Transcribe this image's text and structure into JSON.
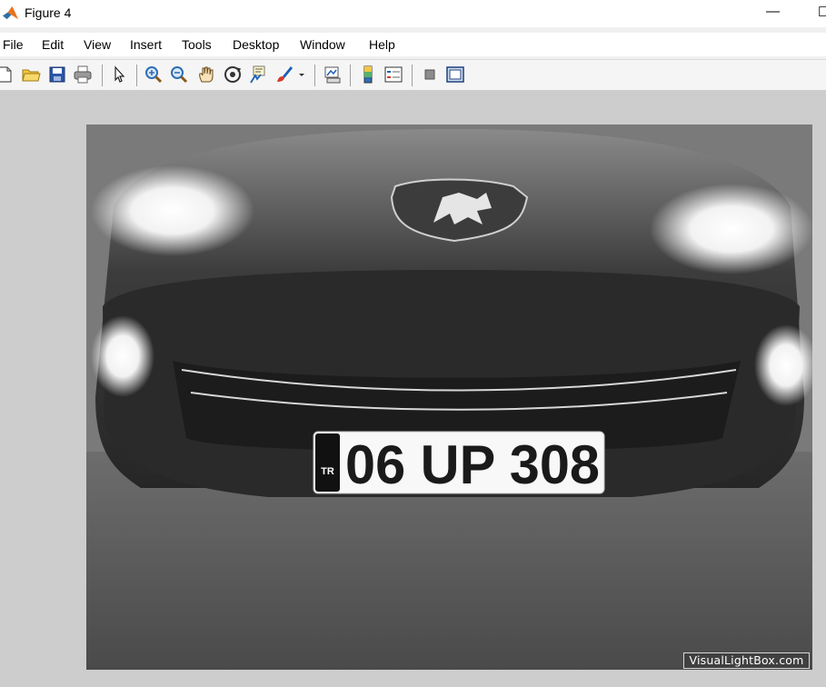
{
  "window": {
    "title": "Figure 4",
    "minimize_glyph": "—",
    "maximize_glyph": "☐"
  },
  "menu": {
    "items": [
      "File",
      "Edit",
      "View",
      "Insert",
      "Tools",
      "Desktop",
      "Window",
      "Help"
    ]
  },
  "toolbar": {
    "icons": [
      "new-figure-icon",
      "open-file-icon",
      "save-icon",
      "print-icon",
      "select-arrow-icon",
      "zoom-in-icon",
      "zoom-out-icon",
      "pan-hand-icon",
      "rotate-3d-icon",
      "data-cursor-icon",
      "brush-icon",
      "brush-dropdown-icon",
      "link-plot-icon",
      "insert-colorbar-icon",
      "insert-legend-icon",
      "hide-plot-tools-icon",
      "show-plot-tools-icon"
    ]
  },
  "image": {
    "license_plate": {
      "country_code": "TR",
      "number": "06 UP 308"
    },
    "watermark": "VisualLightBox.com"
  },
  "colors": {
    "canvas_background": "#cdcdcd",
    "window_background": "#ffffff"
  }
}
